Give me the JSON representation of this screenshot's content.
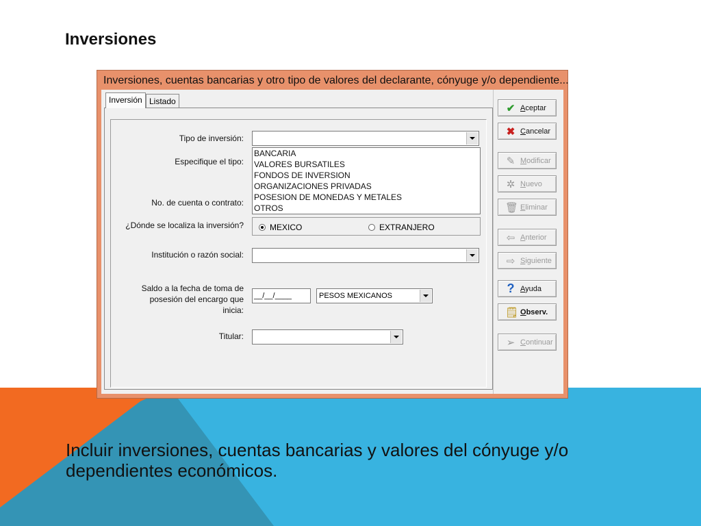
{
  "slide": {
    "title": "Inversiones",
    "caption": "Incluir inversiones, cuentas bancarias y valores del cónyuge y/o dependientes económicos."
  },
  "window": {
    "title": "Inversiones, cuentas bancarias y otro tipo de valores del declarante, cónyuge y/o dependiente..."
  },
  "tabs": [
    {
      "label": "Inversión"
    },
    {
      "label": "Listado"
    }
  ],
  "form": {
    "tipo_label": "Tipo de inversión:",
    "tipo_value": "",
    "especifique_label": "Especifique el tipo:",
    "especifique_options": [
      "BANCARIA",
      "VALORES BURSATILES",
      "FONDOS DE INVERSION",
      "ORGANIZACIONES PRIVADAS",
      "POSESION DE MONEDAS Y METALES",
      "OTROS"
    ],
    "cuenta_label": "No. de cuenta o contrato:",
    "localiza_label": "¿Dónde se localiza la inversión?",
    "radio_mexico": "MEXICO",
    "radio_extranjero": "EXTRANJERO",
    "selected_location": "MEXICO",
    "institucion_label": "Institución o razón social:",
    "institucion_value": "",
    "saldo_label_1": "Saldo a la fecha de toma de",
    "saldo_label_2": "posesión del encargo que",
    "saldo_label_3": "inicia:",
    "date_value": "__/__/____",
    "moneda_value": "PESOS MEXICANOS",
    "titular_label": "Titular:",
    "titular_value": ""
  },
  "buttons": {
    "aceptar": "Aceptar",
    "cancelar": "Cancelar",
    "modificar": "Modificar",
    "nuevo": "Nuevo",
    "eliminar": "Eliminar",
    "anterior": "Anterior",
    "siguiente": "Siguiente",
    "ayuda": "Ayuda",
    "observ": "Observ.",
    "continuar": "Continuar"
  },
  "colors": {
    "window_frame": "#e8916b",
    "accent_orange": "#f26a21",
    "accent_blue": "#38b3e0",
    "accept_green": "#2e9b2e",
    "cancel_red": "#c8201e"
  },
  "icons": {
    "aceptar": "check-icon",
    "cancelar": "x-icon",
    "modificar": "edit-icon",
    "nuevo": "new-icon",
    "eliminar": "trash-icon",
    "anterior": "arrow-left-icon",
    "siguiente": "arrow-right-icon",
    "ayuda": "help-icon",
    "observ": "notes-icon",
    "continuar": "send-icon"
  }
}
